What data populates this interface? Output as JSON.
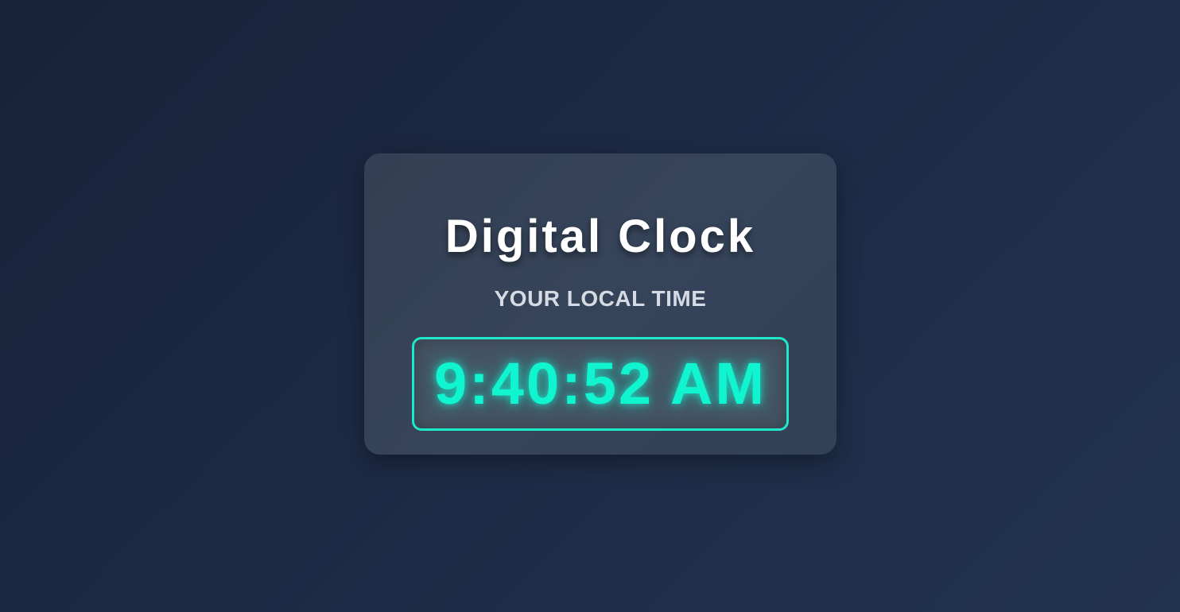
{
  "card": {
    "title": "Digital Clock",
    "subtitle": "YOUR LOCAL TIME",
    "time": "9:40:52 AM"
  },
  "colors": {
    "accent": "#10f5cf",
    "border": "#1de9c8",
    "background": "#1c2a44",
    "card": "#36445a"
  }
}
